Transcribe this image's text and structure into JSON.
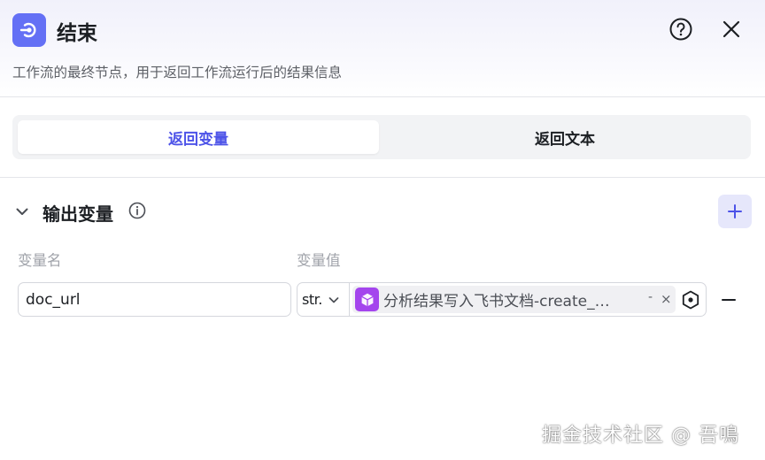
{
  "header": {
    "title": "结束",
    "description": "工作流的最终节点，用于返回工作流运行后的结果信息",
    "node_icon": "end-node-icon",
    "help_icon": "help-circle-icon",
    "close_icon": "close-icon"
  },
  "tabs": [
    {
      "label": "返回变量",
      "active": true
    },
    {
      "label": "返回文本",
      "active": false
    }
  ],
  "section": {
    "title": "输出变量",
    "columns": {
      "name": "变量名",
      "value": "变量值"
    },
    "rows": [
      {
        "name": "doc_url",
        "type": "str.",
        "reference": "分析结果写入飞书文档-create_…",
        "reference_suffix": "-",
        "clear": "×"
      }
    ]
  },
  "watermark": "掘金技术社区 @ 吾鳴",
  "colors": {
    "accent": "#4d53e8",
    "node_icon_bg": "#6470f5",
    "ref_icon_bg": "#a445ed",
    "add_button_bg": "#e6e7fb"
  }
}
